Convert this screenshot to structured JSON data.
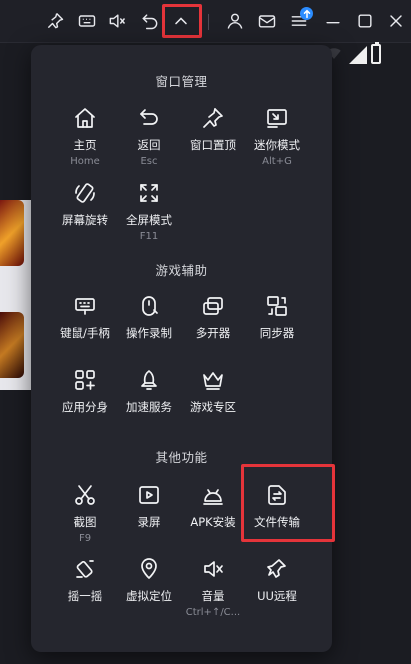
{
  "titlebar": {
    "icons": [
      "pin-icon",
      "keyboard-icon",
      "mute-icon",
      "back-icon",
      "collapse-icon",
      "user-icon",
      "mail-icon",
      "menu-icon",
      "minimize-icon",
      "maximize-icon",
      "close-icon"
    ],
    "highlight_color": "#e5343a",
    "badge_color": "#2b8cff"
  },
  "menu": {
    "sections": [
      {
        "title": "窗口管理",
        "items": [
          {
            "label": "主页",
            "sub": "Home",
            "icon": "home-icon"
          },
          {
            "label": "返回",
            "sub": "Esc",
            "icon": "back-arrow-icon"
          },
          {
            "label": "窗口置顶",
            "sub": "",
            "icon": "pin-icon"
          },
          {
            "label": "迷你模式",
            "sub": "Alt+G",
            "icon": "mini-mode-icon"
          },
          {
            "label": "屏幕旋转",
            "sub": "",
            "icon": "rotate-icon"
          },
          {
            "label": "全屏模式",
            "sub": "F11",
            "icon": "fullscreen-icon"
          }
        ]
      },
      {
        "title": "游戏辅助",
        "items": [
          {
            "label": "键鼠/手柄",
            "sub": "",
            "icon": "keyboard-icon"
          },
          {
            "label": "操作录制",
            "sub": "",
            "icon": "record-icon"
          },
          {
            "label": "多开器",
            "sub": "",
            "icon": "multi-instance-icon"
          },
          {
            "label": "同步器",
            "sub": "",
            "icon": "sync-icon"
          },
          {
            "label": "应用分身",
            "sub": "",
            "icon": "app-clone-icon"
          },
          {
            "label": "加速服务",
            "sub": "",
            "icon": "rocket-icon"
          },
          {
            "label": "游戏专区",
            "sub": "",
            "icon": "crown-icon"
          }
        ]
      },
      {
        "title": "其他功能",
        "items": [
          {
            "label": "截图",
            "sub": "F9",
            "icon": "scissors-icon"
          },
          {
            "label": "录屏",
            "sub": "",
            "icon": "screen-record-icon"
          },
          {
            "label": "APK安装",
            "sub": "",
            "icon": "android-icon"
          },
          {
            "label": "文件传输",
            "sub": "",
            "icon": "file-transfer-icon"
          },
          {
            "label": "摇一摇",
            "sub": "",
            "icon": "shake-icon"
          },
          {
            "label": "虚拟定位",
            "sub": "",
            "icon": "location-icon"
          },
          {
            "label": "音量",
            "sub": "Ctrl+↑/C...",
            "icon": "volume-icon"
          },
          {
            "label": "UU远程",
            "sub": "",
            "icon": "remote-icon"
          }
        ]
      }
    ]
  }
}
